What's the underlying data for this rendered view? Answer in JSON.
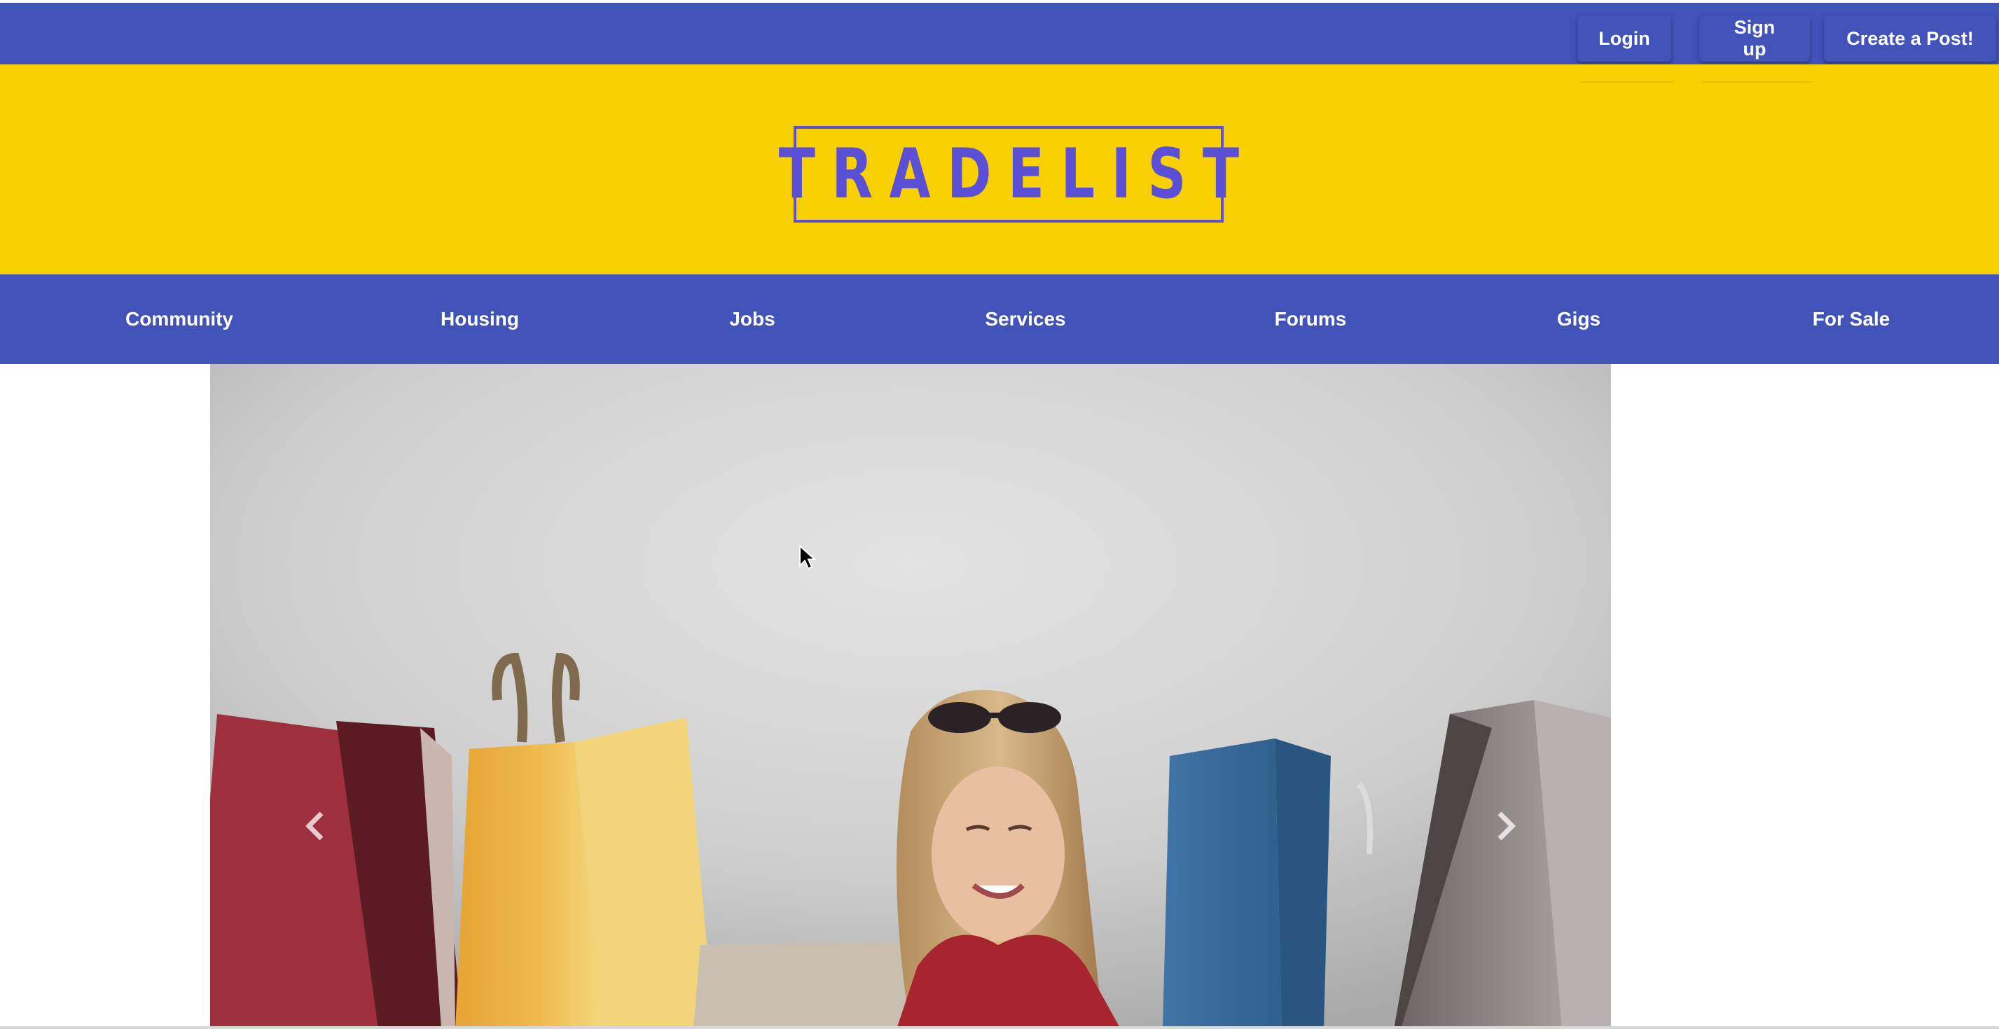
{
  "header": {
    "login_label": "Login",
    "signup_label": "Sign up",
    "create_post_label": "Create a Post!"
  },
  "brand": {
    "logo_text": "TRADELIST"
  },
  "nav": {
    "items": [
      {
        "label": "Community"
      },
      {
        "label": "Housing"
      },
      {
        "label": "Jobs"
      },
      {
        "label": "Services"
      },
      {
        "label": "Forums"
      },
      {
        "label": "Gigs"
      },
      {
        "label": "For Sale"
      }
    ]
  },
  "carousel": {
    "prev_icon": "chevron-left-icon",
    "next_icon": "chevron-right-icon"
  },
  "colors": {
    "primary": "#4152b9",
    "brand_yellow": "#f9d000",
    "logo_purple": "#5b4fd6"
  }
}
